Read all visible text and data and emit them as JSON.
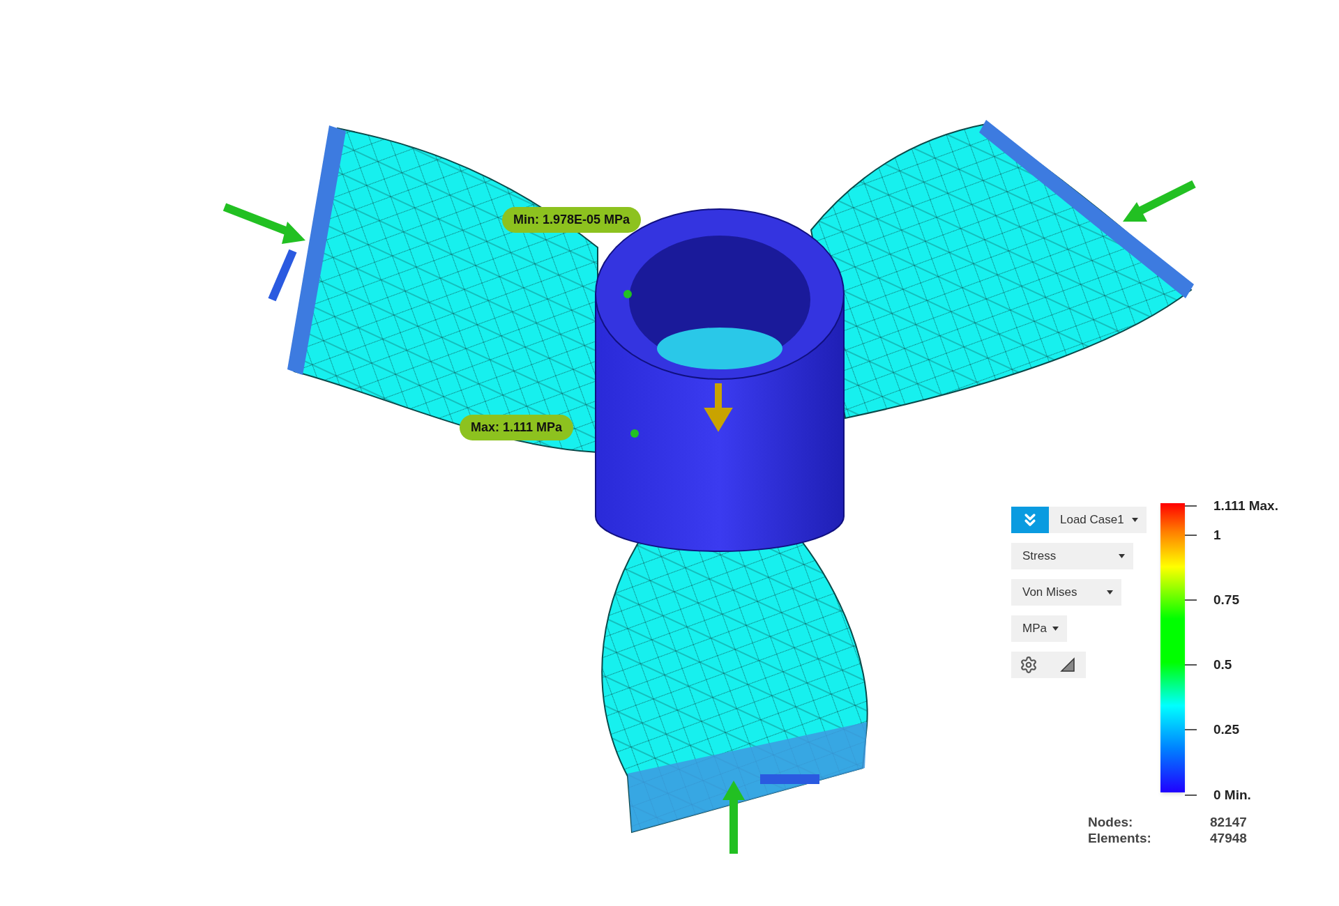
{
  "probes": [
    {
      "kind": "min",
      "label": "Min: 1.978E-05 MPa"
    },
    {
      "kind": "max",
      "label": "Max: 1.111 MPa"
    }
  ],
  "legend": {
    "load_case": "Load Case1",
    "result_type": "Stress",
    "component": "Von Mises",
    "unit": "MPa",
    "ticks": [
      "1.111 Max.",
      "1",
      "0.75",
      "0.5",
      "0.25",
      "0 Min."
    ]
  },
  "stats": [
    {
      "label": "Nodes:",
      "value": "82147"
    },
    {
      "label": "Elements:",
      "value": "47948"
    }
  ]
}
